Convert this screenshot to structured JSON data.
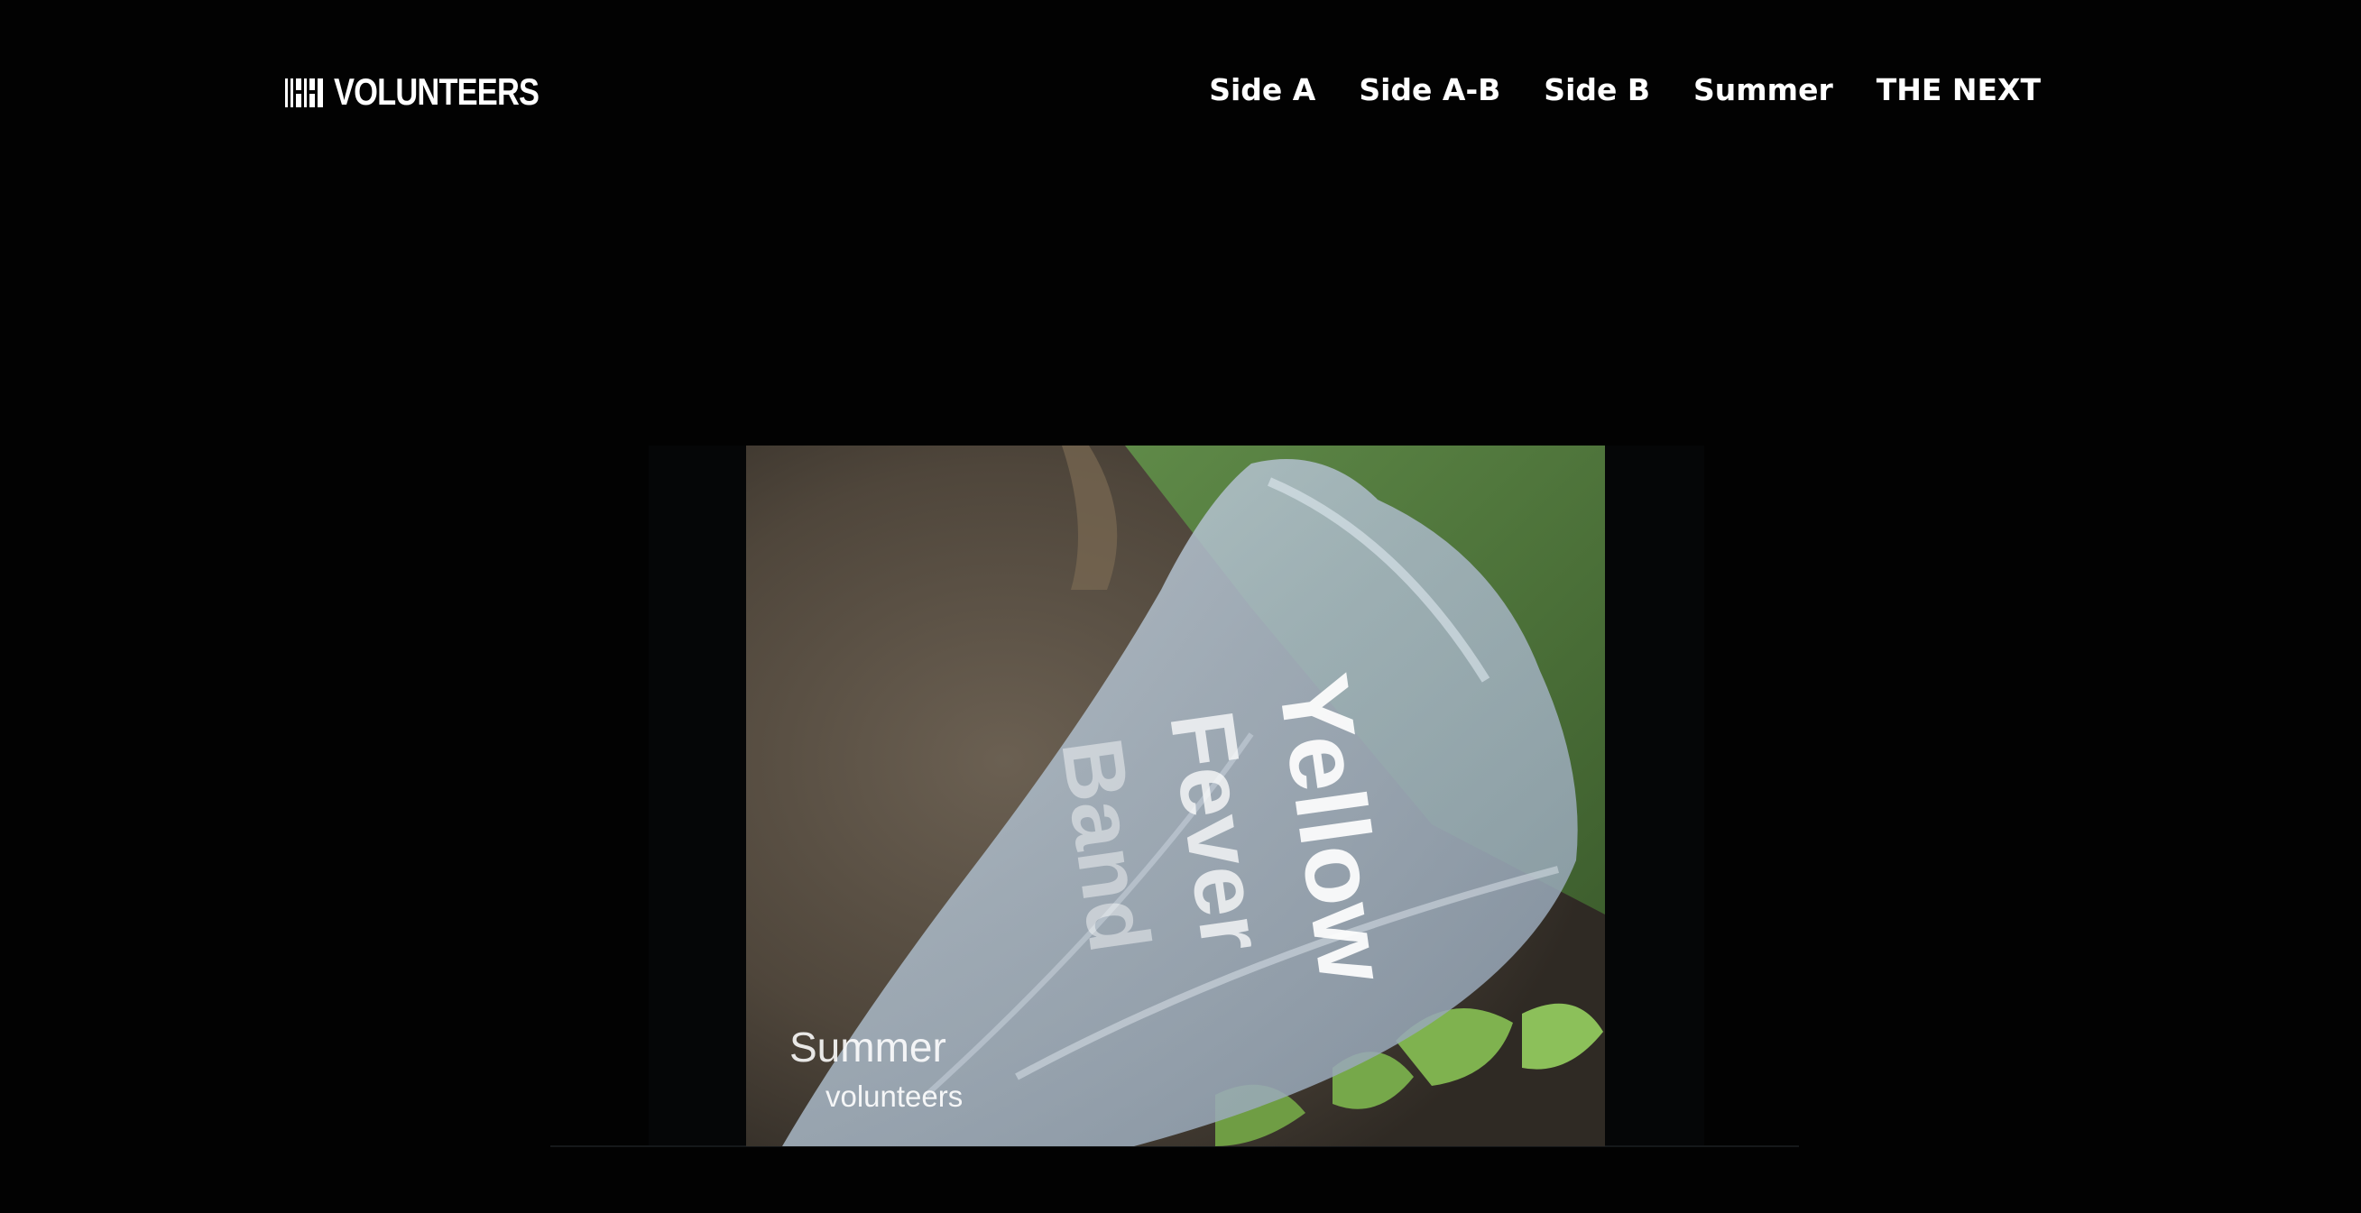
{
  "header": {
    "logo_text": "VOLUNTEERS",
    "logo_icon": "barcode-logo-icon",
    "nav": [
      {
        "label": "Side A"
      },
      {
        "label": "Side A-B"
      },
      {
        "label": "Side B"
      },
      {
        "label": "Summer"
      },
      {
        "label": "THE NEXT"
      }
    ]
  },
  "video": {
    "bag_text": [
      "Yellow",
      "Fever",
      "Band"
    ],
    "caption_title": "Summer",
    "caption_sub": "volunteers"
  },
  "colors": {
    "background": "#020202",
    "text": "#ffffff"
  }
}
